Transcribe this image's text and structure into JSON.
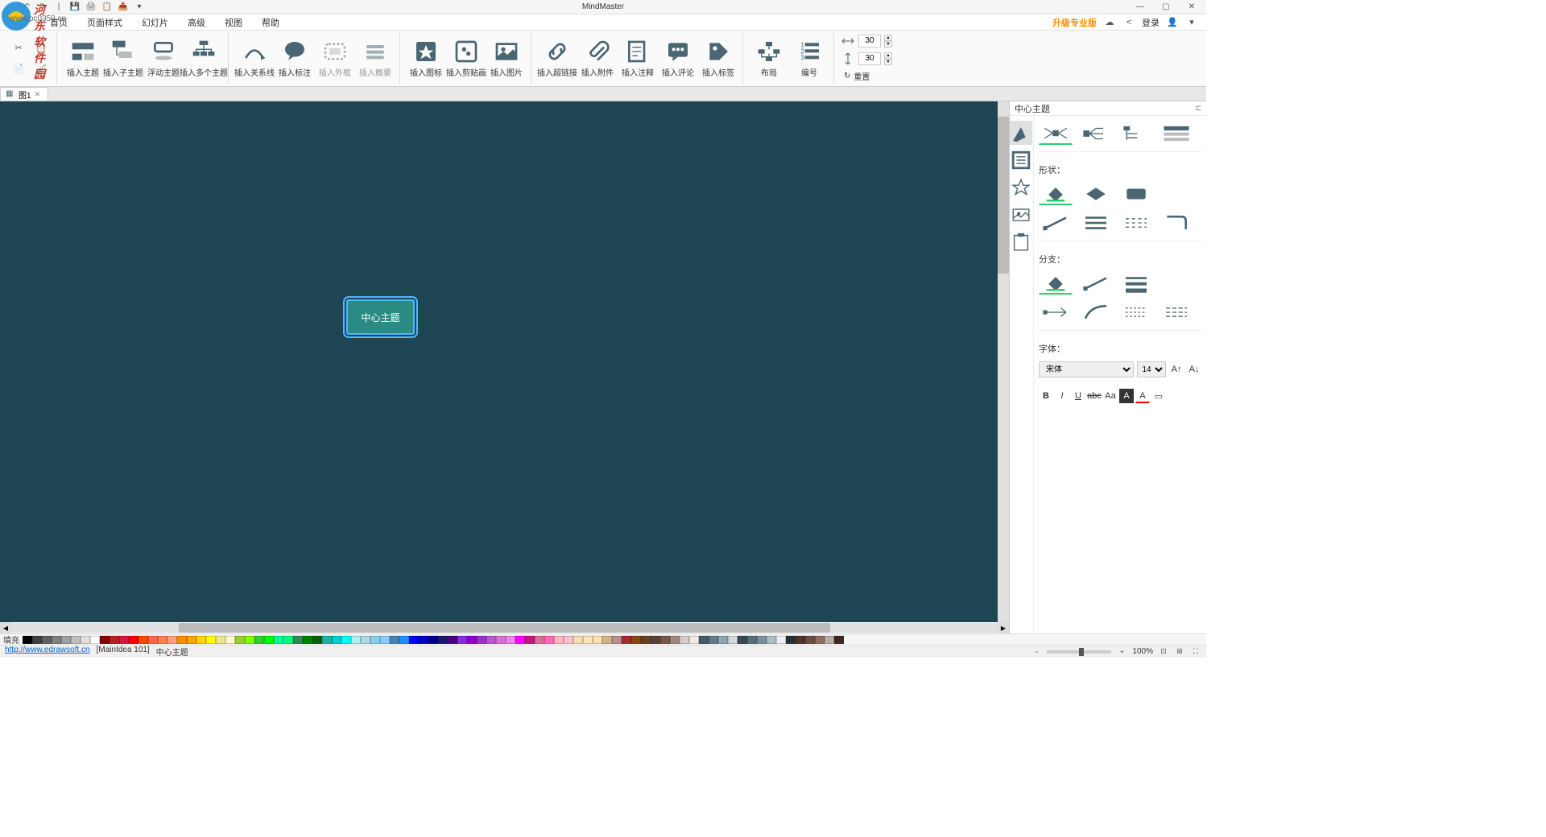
{
  "title": "MindMaster",
  "watermark": {
    "text1": "河东软件园",
    "text2": "www.pc0359.cn"
  },
  "menu": {
    "items": [
      "首页",
      "页面样式",
      "幻灯片",
      "高级",
      "视图",
      "帮助"
    ],
    "upgrade": "升级专业版",
    "login": "登录"
  },
  "ribbon": {
    "insert_topic": "插入主题",
    "insert_subtopic": "插入子主题",
    "floating_topic": "浮动主题",
    "insert_multi": "插入多个主题",
    "insert_relation": "插入关系线",
    "insert_callout": "插入标注",
    "insert_boundary": "插入外框",
    "insert_summary": "插入概要",
    "insert_icon": "插入图标",
    "insert_clipart": "插入剪贴画",
    "insert_image": "插入图片",
    "insert_hyperlink": "插入超链接",
    "insert_attachment": "插入附件",
    "insert_note": "插入注释",
    "insert_comment": "插入评论",
    "insert_tag": "插入标签",
    "layout": "布局",
    "numbering": "编号",
    "width_val": "30",
    "height_val": "30",
    "reset": "重置"
  },
  "doc_tab": {
    "name": "图1"
  },
  "canvas": {
    "center_topic": "中心主题"
  },
  "right_panel": {
    "title": "中心主题",
    "shape_label": "形状：",
    "branch_label": "分支：",
    "font_label": "字体：",
    "font_name": "宋体",
    "font_size": "14"
  },
  "color_bar": {
    "label": "填充"
  },
  "colors": [
    "#000000",
    "#404040",
    "#606060",
    "#808080",
    "#a0a0a0",
    "#c0c0c0",
    "#e0e0e0",
    "#ffffff",
    "#8b0000",
    "#b22222",
    "#dc143c",
    "#ff0000",
    "#ff4500",
    "#ff6347",
    "#ff7f50",
    "#ffa07a",
    "#ff8c00",
    "#ffa500",
    "#ffd700",
    "#ffff00",
    "#f0e68c",
    "#fffacd",
    "#9acd32",
    "#7fff00",
    "#32cd32",
    "#00ff00",
    "#00fa9a",
    "#00ff7f",
    "#2e8b57",
    "#008000",
    "#006400",
    "#20b2aa",
    "#00ced1",
    "#00ffff",
    "#afeeee",
    "#add8e6",
    "#87ceeb",
    "#87cefa",
    "#4682b4",
    "#1e90ff",
    "#0000ff",
    "#0000cd",
    "#00008b",
    "#191970",
    "#4b0082",
    "#8a2be2",
    "#9400d3",
    "#9932cc",
    "#ba55d3",
    "#da70d6",
    "#ee82ee",
    "#ff00ff",
    "#c71585",
    "#db7093",
    "#ff69b4",
    "#ffb6c1",
    "#ffc0cb",
    "#f5deb3",
    "#ffe4b5",
    "#ffdead",
    "#d2b48c",
    "#bc8f8f",
    "#a52a2a",
    "#8b4513",
    "#654321",
    "#5d4037",
    "#795548",
    "#a1887f",
    "#d7ccc8",
    "#efebe9",
    "#455a64",
    "#607d8b",
    "#90a4ae",
    "#cfd8dc",
    "#37474f",
    "#546e7a",
    "#78909c",
    "#b0bec5",
    "#eceff1",
    "#263238",
    "#4e342e",
    "#6d4c41",
    "#8d6e63",
    "#bcaaa4",
    "#3e2723"
  ],
  "status": {
    "url": "http://www.edrawsoft.cn",
    "node_info": "[MainIdea 101]",
    "node_name": "中心主题",
    "zoom": "100%"
  }
}
